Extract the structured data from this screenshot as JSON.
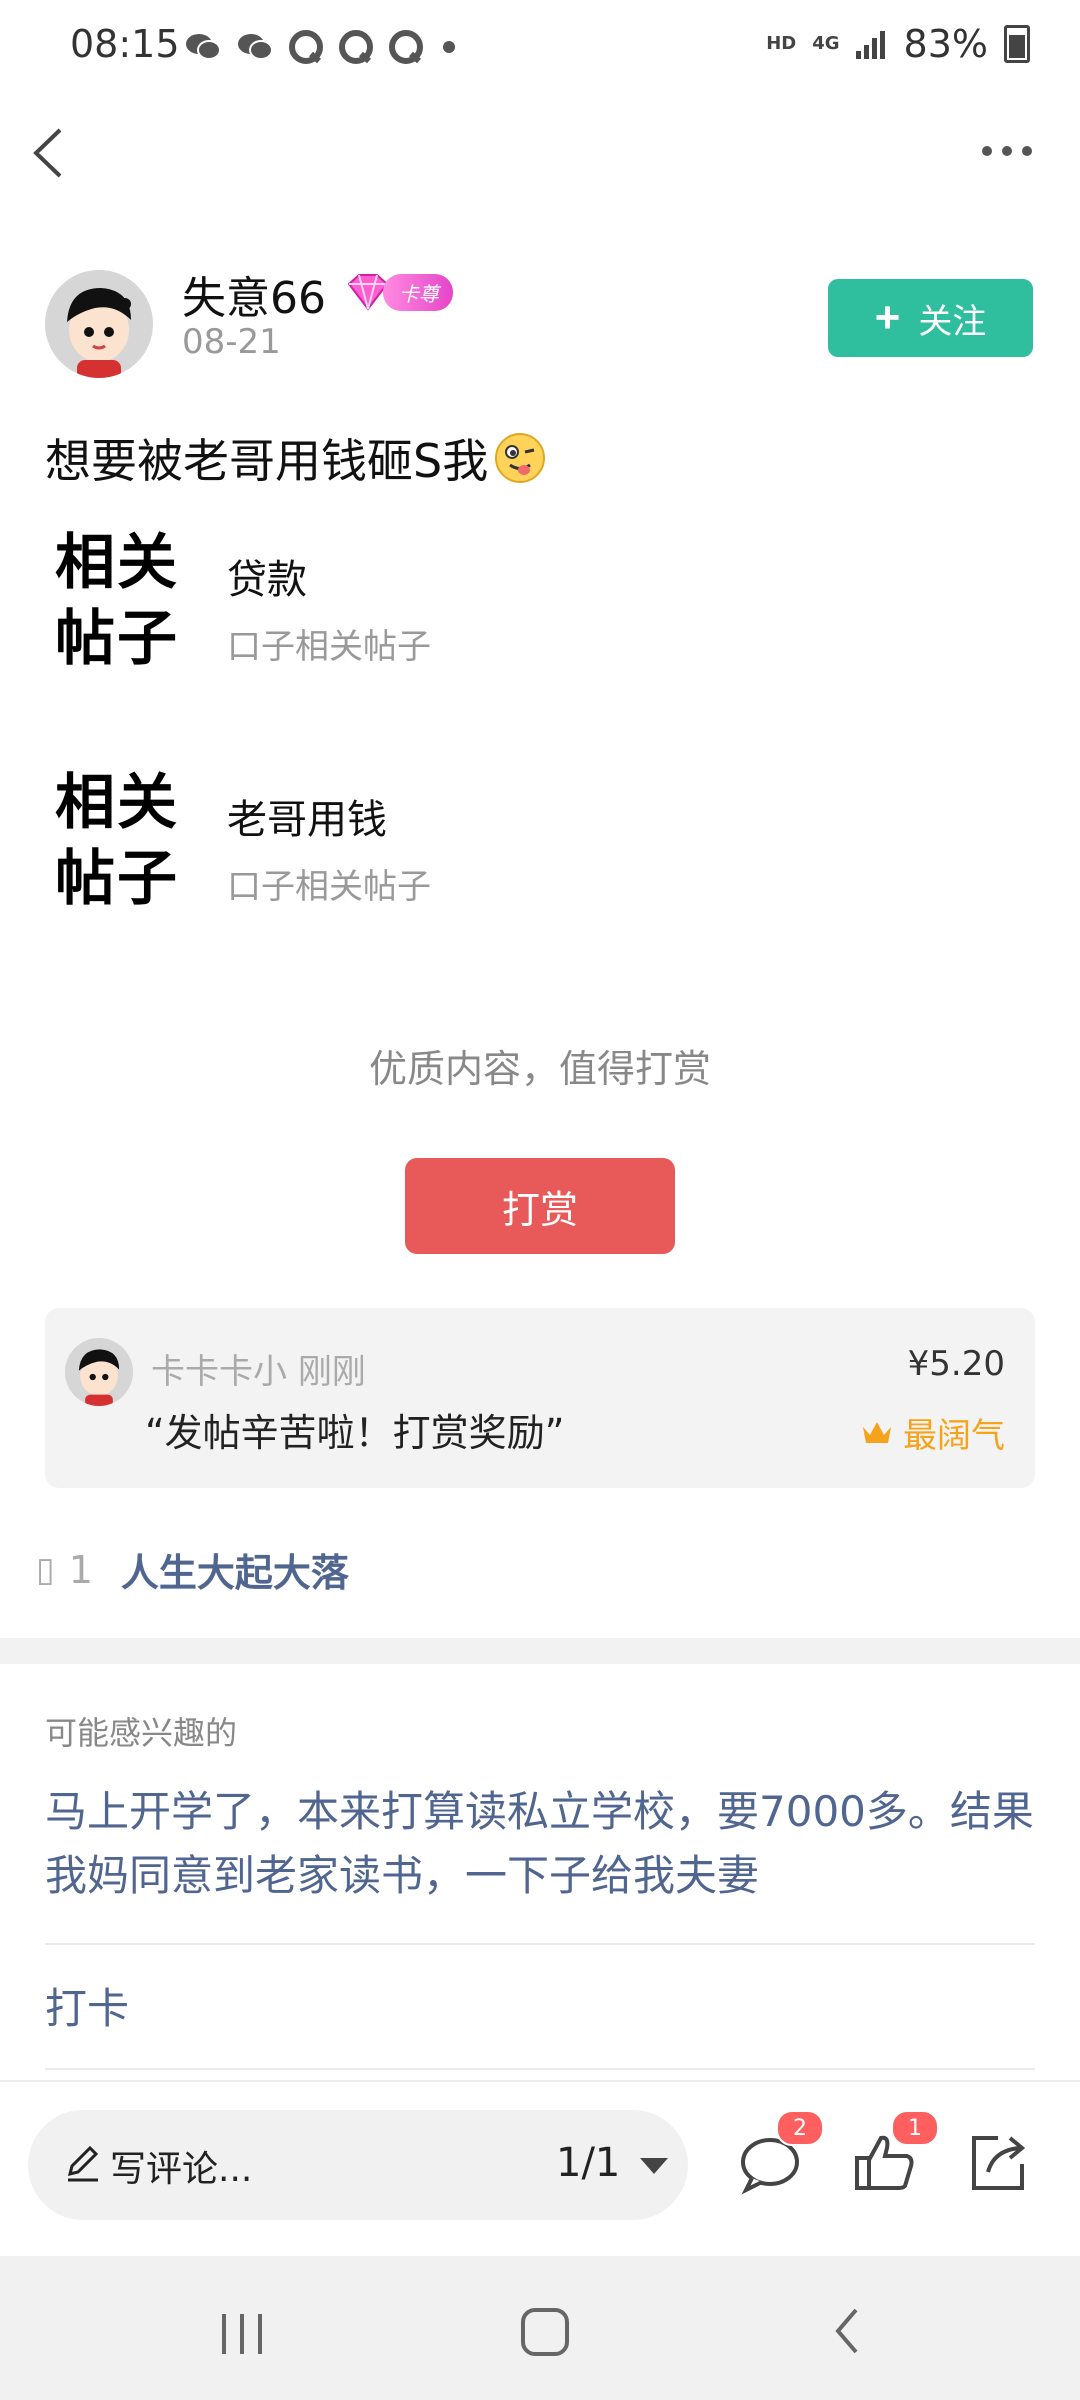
{
  "status_bar": {
    "time": "08:15",
    "notification_icons": [
      "wechat-icon",
      "wechat-icon",
      "qq-icon",
      "qq-icon",
      "qq-icon",
      "dot-icon"
    ],
    "network_hd": "HD",
    "network_gen": "4G",
    "battery_percent": "83%"
  },
  "post": {
    "author": {
      "name": "失意66",
      "vip_tag": "卡尊",
      "date": "08-21"
    },
    "follow_label": "关注",
    "title": "想要被老哥用钱砸S我",
    "related": [
      {
        "logo": "相关帖子",
        "logo_line1": "相关",
        "logo_line2": "帖子",
        "name": "贷款",
        "subtitle": "口子相关帖子"
      },
      {
        "logo": "相关帖子",
        "logo_line1": "相关",
        "logo_line2": "帖子",
        "name": "老哥用钱",
        "subtitle": "口子相关帖子"
      }
    ],
    "reward_prompt": "优质内容，值得打赏",
    "reward_button": "打赏",
    "reward_record": {
      "user": "卡卡卡小",
      "time": "刚刚",
      "message": "“发帖辛苦啦！打赏奖励”",
      "amount": "¥5.20",
      "tag": "最阔气"
    },
    "topic": {
      "count": "1",
      "name": "人生大起大落"
    }
  },
  "recommendations": {
    "label": "可能感兴趣的",
    "items": [
      "马上开学了，本来打算读私立学校，要7000多。结果我妈同意到老家读书，一下子给我夫妻",
      "打卡"
    ]
  },
  "bottom_bar": {
    "comment_placeholder": "写评论...",
    "page_indicator": "1/1",
    "comment_count": "2",
    "like_count": "1"
  },
  "colors": {
    "accent_green": "#2fbf9e",
    "reward_red": "#e85959",
    "link_blue": "#506690",
    "gold": "#f5a31a",
    "badge_red": "#ff5f5f"
  }
}
